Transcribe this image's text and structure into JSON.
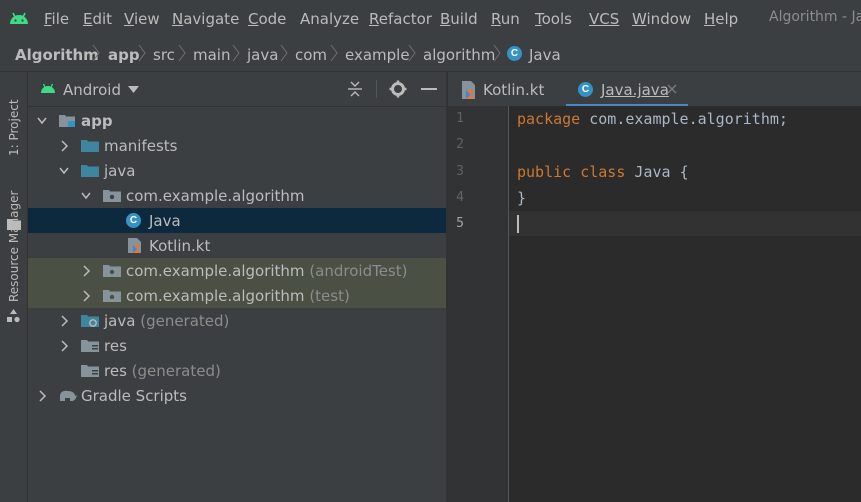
{
  "menubar": {
    "items": [
      {
        "label": "File",
        "mnemonic": "F",
        "rest": "ile"
      },
      {
        "label": "Edit",
        "mnemonic": "E",
        "rest": "dit"
      },
      {
        "label": "View",
        "mnemonic": "V",
        "rest": "iew"
      },
      {
        "label": "Navigate",
        "mnemonic": "N",
        "rest": "avigate"
      },
      {
        "label": "Code",
        "mnemonic": "C",
        "rest": "ode"
      },
      {
        "label": "Analyze",
        "mnemonic": "",
        "rest": "Analyze"
      },
      {
        "label": "Refactor",
        "mnemonic": "R",
        "rest": "efactor"
      },
      {
        "label": "Build",
        "mnemonic": "B",
        "rest": "uild"
      },
      {
        "label": "Run",
        "mnemonic": "R",
        "rest": "un"
      },
      {
        "label": "Tools",
        "mnemonic": "T",
        "rest": "ools"
      },
      {
        "label": "VCS",
        "mnemonic": "",
        "rest": "VCS"
      },
      {
        "label": "Window",
        "mnemonic": "W",
        "rest": "indow"
      },
      {
        "label": "Help",
        "mnemonic": "H",
        "rest": "elp"
      }
    ],
    "window_title": "Algorithm - Ja"
  },
  "breadcrumb": [
    "Algorithm",
    "app",
    "src",
    "main",
    "java",
    "com",
    "example",
    "algorithm",
    "Java"
  ],
  "leftstrip": {
    "project_label": "1: Project",
    "resource_label": "Resource Manager"
  },
  "project_panel": {
    "view_selector": "Android",
    "tree": [
      {
        "label": "app",
        "suffix": ""
      },
      {
        "label": "manifests",
        "suffix": ""
      },
      {
        "label": "java",
        "suffix": ""
      },
      {
        "label": "com.example.algorithm",
        "suffix": ""
      },
      {
        "label": "Java",
        "suffix": ""
      },
      {
        "label": "Kotlin.kt",
        "suffix": ""
      },
      {
        "label": "com.example.algorithm",
        "suffix": "(androidTest)"
      },
      {
        "label": "com.example.algorithm",
        "suffix": "(test)"
      },
      {
        "label": "java",
        "suffix": "(generated)"
      },
      {
        "label": "res",
        "suffix": ""
      },
      {
        "label": "res",
        "suffix": "(generated)"
      },
      {
        "label": "Gradle Scripts",
        "suffix": ""
      }
    ]
  },
  "editor_tabs": [
    {
      "label": "Kotlin.kt",
      "active": false
    },
    {
      "label": "Java.java",
      "active": true
    }
  ],
  "editor": {
    "line_numbers": [
      "1",
      "2",
      "3",
      "4",
      "5"
    ],
    "code": {
      "l1_kw": "package",
      "l1_rest": " com.example.algorithm;",
      "l3_kw1": "public",
      "l3_kw2": "class",
      "l3_name": "Java",
      "l3_brace": "{",
      "l4": "}"
    }
  },
  "icon_letters": {
    "class_icon": "C"
  },
  "colors": {
    "accent": "#4a88c7",
    "keyword": "#cc7832",
    "selection": "#0d293e",
    "test_bg": "#4a5044"
  }
}
